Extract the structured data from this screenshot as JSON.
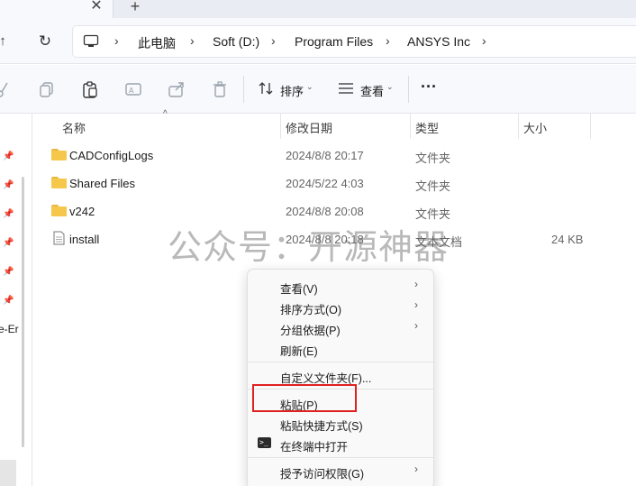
{
  "tabs": {
    "close_glyph": "✕",
    "new_glyph": "+"
  },
  "nav": {
    "up_glyph": "↑",
    "refresh_glyph": "↻"
  },
  "breadcrumb": [
    {
      "label": "此电脑"
    },
    {
      "label": "Soft (D:)"
    },
    {
      "label": "Program Files"
    },
    {
      "label": "ANSYS Inc"
    }
  ],
  "commandbar": {
    "sort_label": "排序",
    "view_label": "查看",
    "more_label": "···"
  },
  "sidebar": {
    "partial_text": "e-Er"
  },
  "columns": {
    "name": "名称",
    "modified": "修改日期",
    "type": "类型",
    "size": "大小"
  },
  "files": [
    {
      "name": "CADConfigLogs",
      "date": "2024/8/8 20:17",
      "type": "文件夹",
      "size": "",
      "icon": "folder-icon"
    },
    {
      "name": "Shared Files",
      "date": "2024/5/22 4:03",
      "type": "文件夹",
      "size": "",
      "icon": "folder-icon"
    },
    {
      "name": "v242",
      "date": "2024/8/8 20:08",
      "type": "文件夹",
      "size": "",
      "icon": "folder-icon"
    },
    {
      "name": "install",
      "date": "2024/8/8 20:18",
      "type": "文本文档",
      "size": "24 KB",
      "icon": "text-file-icon"
    }
  ],
  "watermark": "公众号：开源神器",
  "context_menu": {
    "items": [
      {
        "label": "查看(V)",
        "submenu": true
      },
      {
        "label": "排序方式(O)",
        "submenu": true
      },
      {
        "label": "分组依据(P)",
        "submenu": true
      },
      {
        "label": "刷新(E)",
        "submenu": false
      },
      {
        "label": "自定义文件夹(F)...",
        "submenu": false
      },
      {
        "label": "粘贴(P)",
        "submenu": false,
        "highlighted": true
      },
      {
        "label": "粘贴快捷方式(S)",
        "submenu": false
      },
      {
        "label": "在终端中打开",
        "submenu": false,
        "icon": "terminal-icon"
      },
      {
        "label": "授予访问权限(G)",
        "submenu": true
      }
    ],
    "submenu_glyph": "›",
    "highlight_color": "#e02020"
  }
}
